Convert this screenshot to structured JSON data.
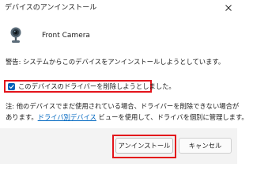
{
  "window": {
    "title": "デバイスのアンインストール",
    "close_icon": "close-icon"
  },
  "device": {
    "icon": "webcam-icon",
    "name": "Front Camera"
  },
  "warning_text": "警告: システムからこのデバイスをアンインストールしようとしています。",
  "checkbox": {
    "label": "このデバイスのドライバーを削除しようとしました。",
    "checked": true,
    "accent_color": "#005fb8"
  },
  "note": {
    "line1": "注: 他のデバイスでまだ使用されている場合、ドライバーを削除できない場合が",
    "line2_prefix": "あります。",
    "link_text": "ドライバ別デバイス",
    "line2_suffix": " ビューを使用して、ドライバを個別に管理します。"
  },
  "buttons": {
    "install_label": "アンインストール",
    "cancel_label": "キャンセル"
  },
  "highlight_color": "#e3141b"
}
